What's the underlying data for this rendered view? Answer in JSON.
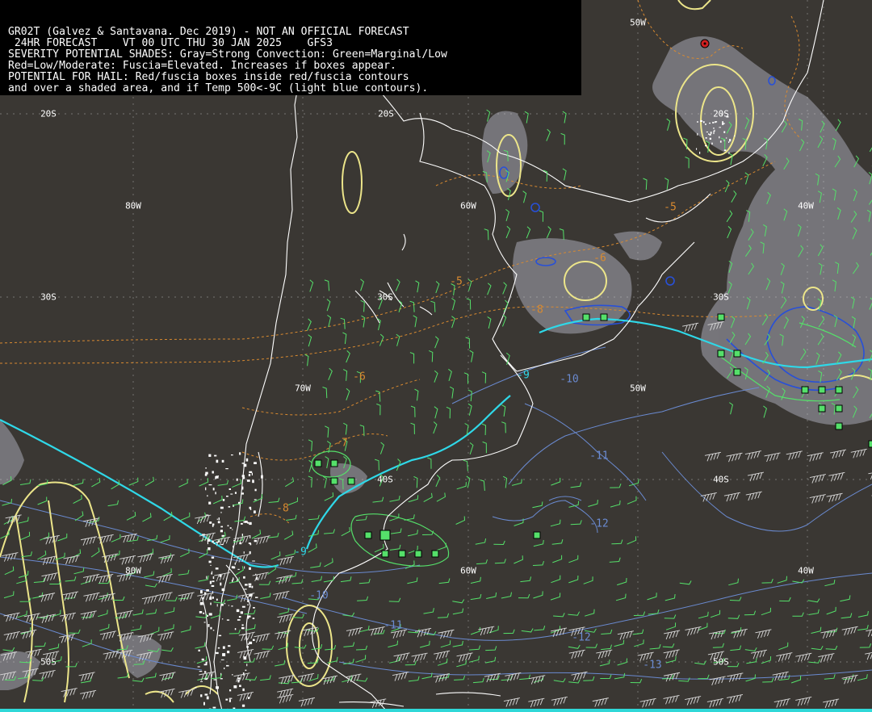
{
  "header": {
    "line1": "GR02T (Galvez & Santavana. Dec 2019) - NOT AN OFFICIAL FORECAST",
    "line2": " 24HR FORECAST    VT 00 UTC THU 30 JAN 2025    GFS3",
    "line3": "SEVERITY POTENTIAL SHADES: Gray=Strong Convection: Green=Marginal/Low",
    "line4": "Red=Low/Moderate: Fuscia=Elevated. Increases if boxes appear.",
    "line5": "POTENTIAL FOR HAIL: Red/fuscia boxes inside red/fuscia contours",
    "line6": "and over a shaded area, and if Temp 500<-9C (light blue contours)."
  },
  "grid_labels": {
    "lat_20s_a": "20S",
    "lat_20s_b": "20S",
    "lat_20s_c": "20S",
    "lat_30s_a": "30S",
    "lat_30s_b": "30S",
    "lat_30s_c": "30S",
    "lat_40s_a": "40S",
    "lat_40s_b": "40S",
    "lat_50s_a": "50S",
    "lat_50s_b": "50S",
    "lon_80w_a": "80W",
    "lon_80w_b": "80W",
    "lon_70w": "70W",
    "lon_60w_a": "60W",
    "lon_60w_b": "60W",
    "lon_50w_a": "50W",
    "lon_50w_b": "50W",
    "lon_40w_a": "40W",
    "lon_40w_b": "40W"
  },
  "contour_labels": {
    "orange_m5": "-5",
    "orange_m6a": "-6",
    "orange_m6b": "-6",
    "orange_m7": "-7",
    "orange_m8": "-8",
    "orange_m8b": "-8",
    "orange_m5b": "-5",
    "cyan_m9a": "-9",
    "cyan_m9b": "-9",
    "blue_m10a": "-10",
    "blue_m10b": "-10",
    "blue_m11a": "-11",
    "blue_m11b": "-11",
    "blue_m12a": "-12",
    "blue_m12b": "-12",
    "blue_m13": "-13"
  },
  "colors": {
    "background": "#3a3733",
    "convection_gray": "#8a8a92",
    "marginal_green": "#55e06a",
    "temp_orange": "#d98a30",
    "temp_cyan": "#2fd8e8",
    "temp_blue": "#6a8ad0",
    "yellow_contour": "#ece58a",
    "coast_white": "#ffffff"
  }
}
